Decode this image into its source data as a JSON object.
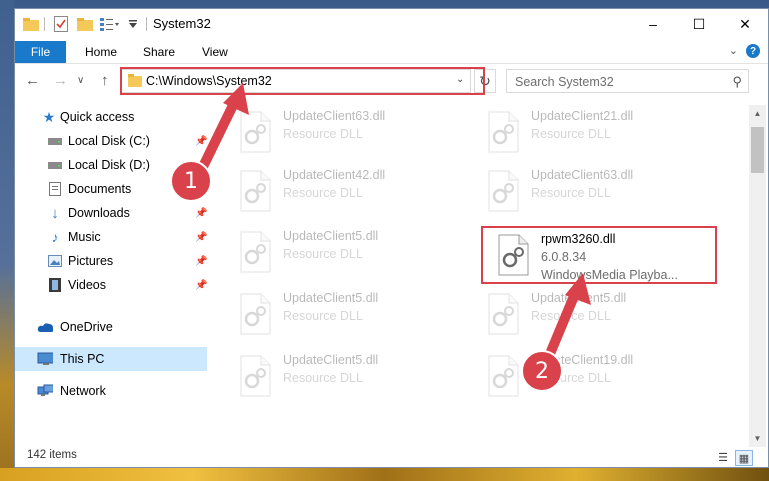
{
  "window": {
    "title": "System32",
    "controls": {
      "minimize": "–",
      "maximize": "☐",
      "close": "✕"
    }
  },
  "ribbon": {
    "file": "File",
    "tabs": [
      "Home",
      "Share",
      "View"
    ]
  },
  "nav": {
    "back": "←",
    "forward": "→",
    "recent": "∨",
    "up": "↑"
  },
  "address": {
    "path": "C:\\Windows\\System32"
  },
  "search": {
    "placeholder": "Search System32"
  },
  "sidebar": {
    "items": [
      {
        "label": "Quick access",
        "icon": "star-icon"
      },
      {
        "label": "Local Disk (C:)",
        "icon": "drive-icon"
      },
      {
        "label": "Local Disk (D:)",
        "icon": "drive-icon"
      },
      {
        "label": "Documents",
        "icon": "documents-icon"
      },
      {
        "label": "Downloads",
        "icon": "download-icon"
      },
      {
        "label": "Music",
        "icon": "music-icon"
      },
      {
        "label": "Pictures",
        "icon": "pictures-icon"
      },
      {
        "label": "Videos",
        "icon": "videos-icon"
      },
      {
        "label": "OneDrive",
        "icon": "cloud-icon"
      },
      {
        "label": "This PC",
        "icon": "computer-icon"
      },
      {
        "label": "Network",
        "icon": "network-icon"
      }
    ]
  },
  "files": {
    "left": [
      {
        "name": "UpdateClient63.dll",
        "type": "Resource DLL"
      },
      {
        "name": "UpdateClient42.dll",
        "type": "Resource DLL"
      },
      {
        "name": "UpdateClient5.dll",
        "type": "Resource DLL"
      },
      {
        "name": "UpdateClient5.dll",
        "type": "Resource DLL"
      },
      {
        "name": "UpdateClient5.dll",
        "type": "Resource DLL"
      }
    ],
    "right": [
      {
        "name": "UpdateClient21.dll",
        "type": "Resource DLL"
      },
      {
        "name": "UpdateClient63.dll",
        "type": "Resource DLL"
      },
      {
        "name": "UpdateClient5.dll",
        "type": "Resource DLL"
      },
      {
        "name": "UpdateClient19.dll",
        "type": "Resource DLL"
      }
    ],
    "highlighted": {
      "name": "rpwm3260.dll",
      "version": "6.0.8.34",
      "description": "WindowsMedia Playba..."
    }
  },
  "status": {
    "count": "142 items"
  },
  "annotations": {
    "step1": "1",
    "step2": "2"
  },
  "colors": {
    "accent": "#1979ca",
    "highlight": "#d9424a",
    "selected": "#cce8ff"
  }
}
